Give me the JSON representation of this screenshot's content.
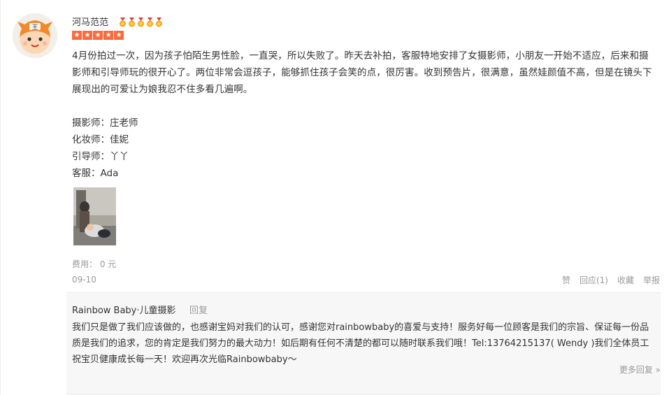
{
  "review": {
    "username": "河马范范",
    "medal_icon": "medal-icon",
    "medal_count": 5,
    "rating": 5,
    "rating_color": "#ff6a3d",
    "star_icon": "star-icon",
    "text": "4月份拍过一次，因为孩子怕陌生男性脸，一直哭，所以失败了。昨天去补拍，客服特地安排了女摄影师，小朋友一开始不适应，后来和摄影师和引导师玩的很开心了。两位非常会逗孩子，能够抓住孩子会笑的点，很厉害。收到预告片，很满意，虽然娃颜值不高，但是在镜头下展现出的可爱让为娘我忍不住多看几遍啊。",
    "staff": [
      "摄影师：庄老师",
      "化妆师：佳妮",
      "引导师：丫丫",
      "客服：Ada"
    ],
    "fee": "费用： 0 元",
    "date": "09-10",
    "actions": {
      "like": "赞",
      "reply": "回应(1)",
      "favorite": "收藏",
      "report": "举报"
    }
  },
  "merchant_reply": {
    "merchant_name": "Rainbow Baby·儿童摄影",
    "reply_label": "回复",
    "text": "我们只是做了我们应该做的，也感谢宝妈对我们的认可，感谢您对rainbowbaby的喜爱与支持！服务好每一位顾客是我们的宗旨、保证每一份品质是我们的追求，您的肯定是我们努力的最大动力！如后期有任何不清楚的都可以随时联系我们哦！Tel:13764215137( Wendy )我们全体员工祝宝贝健康成长每一天！欢迎再次光临Rainbowbaby～",
    "more_replies": "更多回复 »"
  }
}
